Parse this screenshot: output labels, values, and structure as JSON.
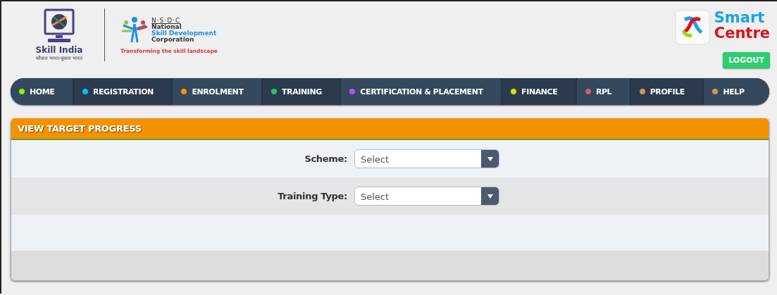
{
  "header": {
    "skill_india": {
      "name": "Skill India",
      "tagline": "कौशल भारत-कुशल भारत"
    },
    "nsdc": {
      "acronym": "N·S·D·C",
      "line_1": "National",
      "line_2": "Skill Development",
      "line_3": "Corporation",
      "tagline": "Transforming the skill landscape"
    },
    "smart_centre": {
      "line_1": "Smart",
      "line_2": "Centre"
    },
    "logout_button": "LOGOUT"
  },
  "nav": [
    {
      "label": "HOME",
      "color": "#99ee00"
    },
    {
      "label": "REGISTRATION",
      "color": "#00c0ff"
    },
    {
      "label": "ENROLMENT",
      "color": "#f39200"
    },
    {
      "label": "TRAINING",
      "color": "#22c55e"
    },
    {
      "label": "CERTIFICATION & PLACEMENT",
      "color": "#b84ef0"
    },
    {
      "label": "FINANCE",
      "color": "#dddd00"
    },
    {
      "label": "RPL",
      "color": "#d45c6a"
    },
    {
      "label": "PROFILE",
      "color": "#c89a58"
    },
    {
      "label": "HELP",
      "color": "#c89a58"
    }
  ],
  "panel": {
    "title": "VIEW TARGET PROGRESS",
    "fields": [
      {
        "label": "Scheme:",
        "placeholder": "Select"
      },
      {
        "label": "Training Type:",
        "placeholder": "Select"
      }
    ]
  }
}
